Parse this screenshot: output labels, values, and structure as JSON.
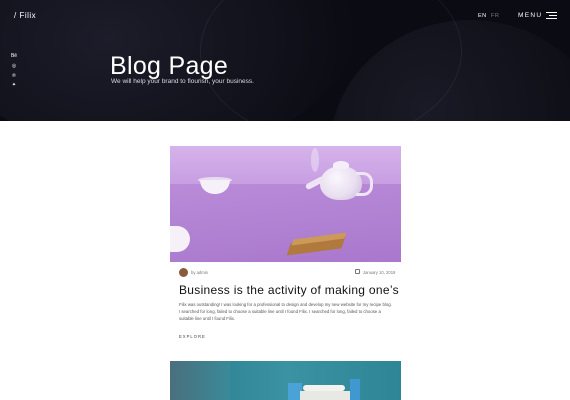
{
  "header": {
    "logo": "/ Filix",
    "lang_en": "EN",
    "lang_fr": "FR",
    "menu_label": "MENU"
  },
  "social": {
    "items": [
      {
        "icon": "behance-icon",
        "glyph": "Bē"
      },
      {
        "icon": "dribbble-icon",
        "glyph": "◎"
      },
      {
        "icon": "pinterest-icon",
        "glyph": "℗"
      },
      {
        "icon": "twitter-icon",
        "glyph": "✦"
      }
    ]
  },
  "hero": {
    "title": "Blog Page",
    "subtitle": "We will help your brand to flourish, your business."
  },
  "post": {
    "author": "by admin",
    "date": "January 10, 2019",
    "title": "Business is the activity of making one’s",
    "excerpt": "Filix was outstanding! I was looking for a professional to design and develop my new website for my recipe blog. I searched for long, failed to choose a suitable line until I found Filix. I searched for long, failed to choose a suitable line until I found Filix.",
    "link": "EXPLORE"
  }
}
